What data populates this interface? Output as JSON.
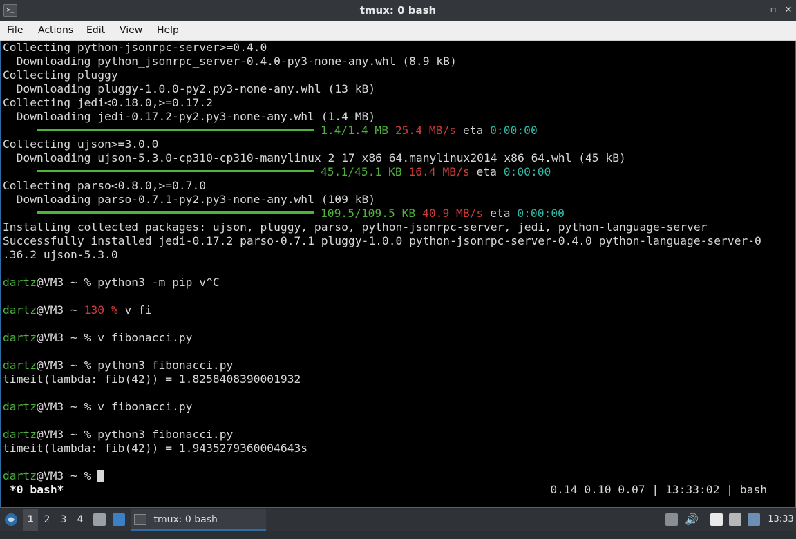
{
  "window": {
    "title": "tmux: 0 bash",
    "app_icon_glyph": ">_",
    "controls": {
      "minimize": "‾",
      "maximize": "▫",
      "close": "✕"
    }
  },
  "menubar": {
    "items": [
      "File",
      "Actions",
      "Edit",
      "View",
      "Help"
    ]
  },
  "terminal": {
    "lines": {
      "l1": "Collecting python-jsonrpc-server>=0.4.0",
      "l2": "  Downloading python_jsonrpc_server-0.4.0-py3-none-any.whl (8.9 kB)",
      "l3": "Collecting pluggy",
      "l4": "  Downloading pluggy-1.0.0-py2.py3-none-any.whl (13 kB)",
      "l5": "Collecting jedi<0.18.0,>=0.17.2",
      "l6": "  Downloading jedi-0.17.2-py2.py3-none-any.whl (1.4 MB)",
      "l8": "Collecting ujson>=3.0.0",
      "l9": "  Downloading ujson-5.3.0-cp310-cp310-manylinux_2_17_x86_64.manylinux2014_x86_64.whl (45 kB)",
      "l11": "Collecting parso<0.8.0,>=0.7.0",
      "l12": "  Downloading parso-0.7.1-py2.py3-none-any.whl (109 kB)",
      "l14": "Installing collected packages: ujson, pluggy, parso, python-jsonrpc-server, jedi, python-language-server",
      "l15": "Successfully installed jedi-0.17.2 parso-0.7.1 pluggy-1.0.0 python-jsonrpc-server-0.4.0 python-language-server-0",
      "l16": ".36.2 ujson-5.3.0"
    },
    "progress": [
      {
        "done": "1.4/1.4 MB",
        "speed": "25.4 MB/s",
        "eta_label": "eta",
        "eta": "0:00:00",
        "fraction": 1.0
      },
      {
        "done": "45.1/45.1 KB",
        "speed": "16.4 MB/s",
        "eta_label": "eta",
        "eta": "0:00:00",
        "fraction": 1.0
      },
      {
        "done": "109.5/109.5 KB",
        "speed": "40.9 MB/s",
        "eta_label": "eta",
        "eta": "0:00:00",
        "fraction": 1.0
      }
    ],
    "prompt_user": "dartz",
    "prompt_host": "@VM3 ~ ",
    "prompt_symbol": "%",
    "commands": [
      {
        "status": "",
        "cmd": " python3 -m pip v^C",
        "output": ""
      },
      {
        "status": "130 ",
        "cmd": " v fi",
        "output": ""
      },
      {
        "status": "",
        "cmd": " v fibonacci.py",
        "output": ""
      },
      {
        "status": "",
        "cmd": " python3 fibonacci.py",
        "output": "timeit(lambda: fib(42)) = 1.8258408390001932"
      },
      {
        "status": "",
        "cmd": " v fibonacci.py",
        "output": ""
      },
      {
        "status": "",
        "cmd": " python3 fibonacci.py",
        "output": "timeit(lambda: fib(42)) = 1.9435279360004643s"
      },
      {
        "status": "",
        "cmd": " ",
        "output": ""
      }
    ],
    "status_left": "*0 bash*",
    "status_right": "0.14 0.10 0.07 | 13:33:02 | bash"
  },
  "taskbar": {
    "workspaces": [
      "1",
      "2",
      "3",
      "4"
    ],
    "active_workspace": "1",
    "task_label": "tmux: 0 bash",
    "clock": "13:33",
    "colors": {
      "accent": "#2e6da4",
      "green": "#4eb23d",
      "red": "#d03b3b",
      "teal": "#2fb5a3"
    }
  }
}
